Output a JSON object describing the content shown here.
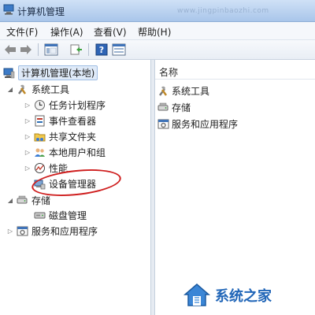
{
  "window": {
    "title": "计算机管理",
    "watermark_url": "www.jingpinbaozhi.com"
  },
  "menu": {
    "items": [
      "文件(F)",
      "操作(A)",
      "查看(V)",
      "帮助(H)"
    ]
  },
  "toolbar": {
    "icons": [
      "back-arrow-icon",
      "forward-arrow-icon",
      "show-hide-tree-icon",
      "export-list-icon",
      "help-icon",
      "properties-icon"
    ]
  },
  "tree": {
    "root": "计算机管理(本地)",
    "system_tools": "系统工具",
    "task_scheduler": "任务计划程序",
    "event_viewer": "事件查看器",
    "shared_folders": "共享文件夹",
    "local_users": "本地用户和组",
    "performance": "性能",
    "device_manager": "设备管理器",
    "storage": "存储",
    "disk_management": "磁盘管理",
    "services_apps": "服务和应用程序"
  },
  "right_pane": {
    "column_header": "名称",
    "items": [
      "系统工具",
      "存储",
      "服务和应用程序"
    ]
  },
  "branding": {
    "site_name": "系统之家"
  },
  "colors": {
    "annotation_circle": "#cf1f1f",
    "brand_blue": "#2166b8",
    "selected_bg": "#dfeaf8"
  }
}
